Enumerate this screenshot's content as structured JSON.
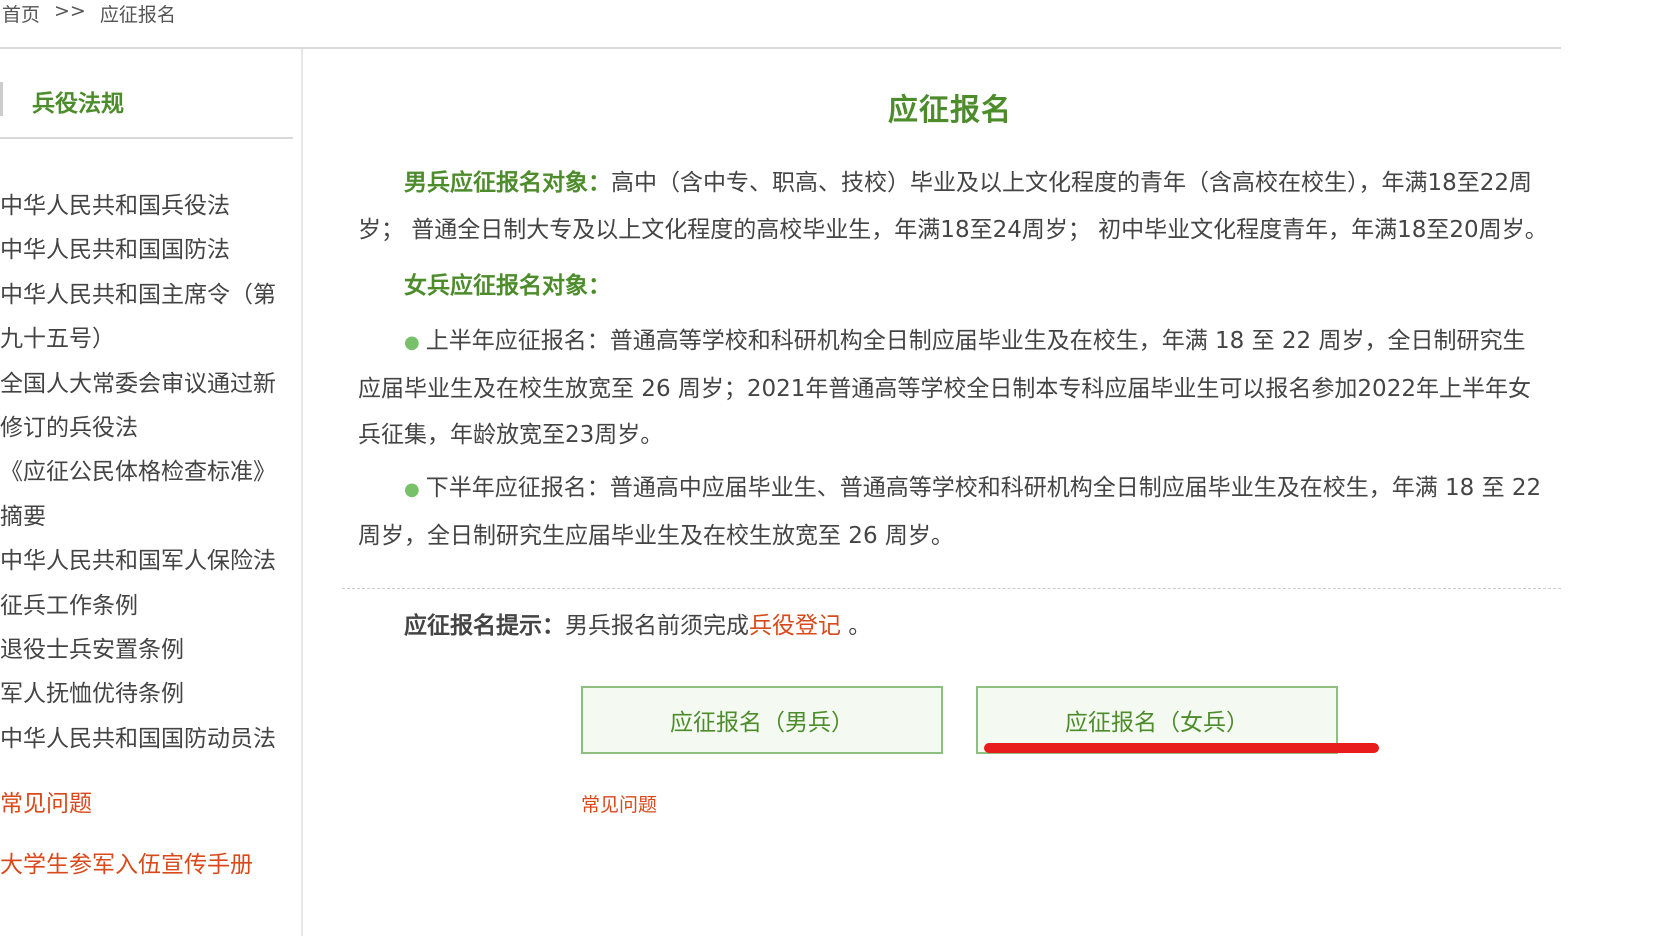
{
  "breadcrumb": {
    "home": "首页",
    "separator": ">>",
    "current": "应征报名"
  },
  "sidebar": {
    "heading": "兵役法规",
    "laws": [
      "中华人民共和国兵役法",
      "中华人民共和国国防法",
      "中华人民共和国主席令（第",
      "九十五号）",
      "全国人大常委会审议通过新",
      "修订的兵役法",
      "《应征公民体格检查标准》",
      "摘要",
      "中华人民共和国军人保险法",
      "征兵工作条例",
      "退役士兵安置条例",
      "军人抚恤优待条例",
      "中华人民共和国国防动员法"
    ],
    "faq_link": "常见问题",
    "handbook_link": "大学生参军入伍宣传手册"
  },
  "main": {
    "title": "应征报名",
    "male": {
      "label": "男兵应征报名对象：",
      "text": "高中（含中专、职高、技校）毕业及以上文化程度的青年（含高校在校生），年满18至22周岁； 普通全日制大专及以上文化程度的高校毕业生，年满18至24周岁； 初中毕业文化程度青年，年满18至20周岁。"
    },
    "female": {
      "label": "女兵应征报名对象：",
      "bullet": "●",
      "first_half": "上半年应征报名：普通高等学校和科研机构全日制应届毕业生及在校生，年满 18 至 22 周岁，全日制研究生应届毕业生及在校生放宽至 26 周岁；2021年普通高等学校全日制本专科应届毕业生可以报名参加2022年上半年女兵征集，年龄放宽至23周岁。",
      "second_half": "下半年应征报名：普通高中应届毕业生、普通高等学校和科研机构全日制应届毕业生及在校生，年满 18 至 22 周岁，全日制研究生应届毕业生及在校生放宽至 26 周岁。"
    },
    "tip": {
      "label": "应征报名提示：",
      "text": "男兵报名前须完成",
      "link": "兵役登记",
      "suffix": " 。"
    },
    "buttons": {
      "male": "应征报名（男兵）",
      "female": "应征报名（女兵）"
    },
    "faq_link": "常见问题"
  },
  "colors": {
    "accent_green": "#4c8c2b",
    "link_orange": "#d84a1b",
    "annotation_red": "#e81c1c"
  }
}
